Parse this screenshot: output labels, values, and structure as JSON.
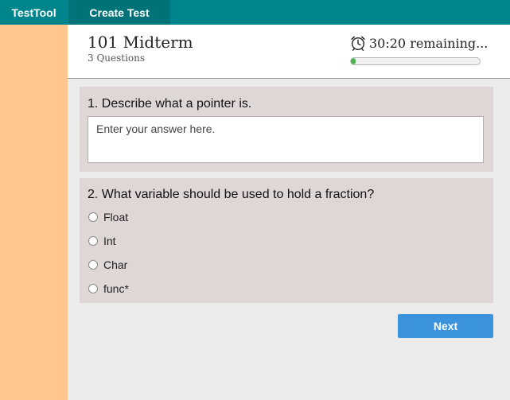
{
  "nav": {
    "brand": "TestTool",
    "create_test_label": "Create Test"
  },
  "header": {
    "title": "101 Midterm",
    "subtitle": "3 Questions",
    "timer_text": "30:20 remaining...",
    "timer_icon": "alarm-clock-icon",
    "progress_fraction": 0.04
  },
  "questions": [
    {
      "text": "1. Describe what a pointer is.",
      "answer_placeholder": "Enter your answer here."
    },
    {
      "text": "2. What variable should be used to hold a fraction?",
      "options": [
        "Float",
        "Int",
        "Char",
        "func*"
      ]
    }
  ],
  "footer": {
    "next_label": "Next"
  },
  "colors": {
    "topbar": "#00858d",
    "sidebar": "#ffc78d",
    "card": "#dfd6d6",
    "next_button": "#3a93dc",
    "progress_fill": "#4bb554"
  }
}
